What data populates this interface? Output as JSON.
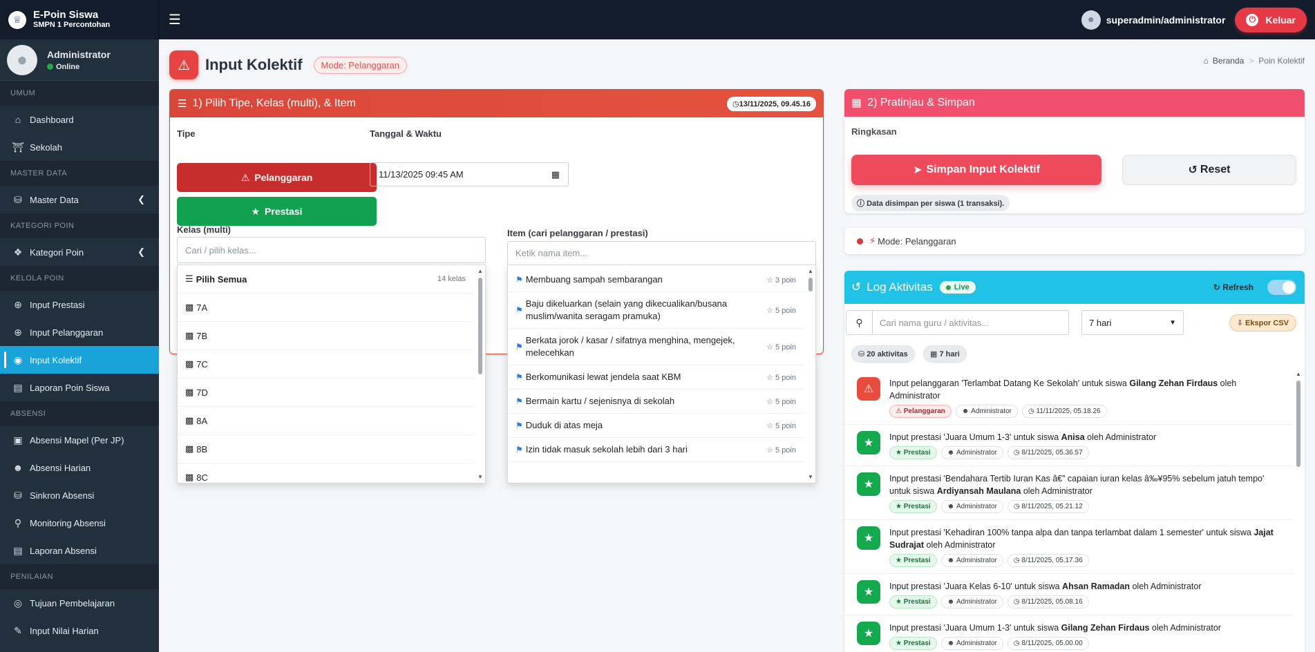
{
  "app": {
    "title": "E-Poin Siswa",
    "subtitle": "SMPN 1 Percontohan"
  },
  "topbar": {
    "user": "superadmin/administrator",
    "logout_label": "Keluar"
  },
  "sidebar": {
    "user_name": "Administrator",
    "user_status": "Online",
    "sections": {
      "umum": "UMUM",
      "master": "MASTER DATA",
      "kategori": "KATEGORI POIN",
      "kelola": "KELOLA POIN",
      "absensi": "ABSENSI",
      "penilaian": "PENILAIAN"
    },
    "items": {
      "dashboard": "Dashboard",
      "sekolah": "Sekolah",
      "master_data": "Master Data",
      "kategori_poin": "Kategori Poin",
      "input_prestasi": "Input Prestasi",
      "input_pelanggaran": "Input Pelanggaran",
      "input_kolektif": "Input Kolektif",
      "laporan_poin": "Laporan Poin Siswa",
      "absensi_mapel": "Absensi Mapel (Per JP)",
      "absensi_harian": "Absensi Harian",
      "sinkron_absensi": "Sinkron Absensi",
      "monitoring_absensi": "Monitoring Absensi",
      "laporan_absensi": "Laporan Absensi",
      "tujuan_pembelajaran": "Tujuan Pembelajaran",
      "input_nilai_harian": "Input Nilai Harian"
    }
  },
  "page": {
    "title": "Input Kolektif",
    "mode_badge": "Mode: Pelanggaran",
    "breadcrumb_home": "Beranda",
    "breadcrumb_current": "Poin Kolektif"
  },
  "form": {
    "header": "1) Pilih Tipe, Kelas (multi), & Item",
    "timestamp": "13/11/2025, 09.45.16",
    "tipe_label": "Tipe",
    "btn_pelanggaran": "Pelanggaran",
    "btn_prestasi": "Prestasi",
    "datetime_label": "Tanggal & Waktu",
    "datetime_value": "11/13/2025 09:45 AM",
    "kelas_label": "Kelas (multi)",
    "kelas_placeholder": "Cari / pilih kelas...",
    "item_label": "Item (cari pelanggaran / prestasi)",
    "item_placeholder": "Ketik nama item...",
    "select_all": "Pilih Semua",
    "kelas_count": "14 kelas",
    "kelas_options": [
      "7A",
      "7B",
      "7C",
      "7D",
      "8A",
      "8B",
      "8C"
    ],
    "item_options": [
      {
        "name": "Membuang sampah sembarangan",
        "poin": "3 poin"
      },
      {
        "name": "Baju dikeluarkan (selain yang dikecualikan/busana muslim/wanita seragam pramuka)",
        "poin": "5 poin"
      },
      {
        "name": "Berkata jorok / kasar / sifatnya menghina, mengejek, melecehkan",
        "poin": "5 poin"
      },
      {
        "name": "Berkomunikasi lewat jendela saat KBM",
        "poin": "5 poin"
      },
      {
        "name": "Bermain kartu / sejenisnya di sekolah",
        "poin": "5 poin"
      },
      {
        "name": "Duduk di atas meja",
        "poin": "5 poin"
      },
      {
        "name": "Izin tidak masuk sekolah lebih dari 3 hari",
        "poin": "5 poin"
      }
    ]
  },
  "preview": {
    "header": "2) Pratinjau & Simpan",
    "summary_label": "Ringkasan",
    "save_label": "Simpan Input Kolektif",
    "reset_label": "Reset",
    "info": "Data disimpan per siswa (1 transaksi).",
    "mode": "Mode: Pelanggaran"
  },
  "log": {
    "title": "Log Aktivitas",
    "live": "Live",
    "refresh": "Refresh",
    "search_placeholder": "Cari nama guru / aktivitas...",
    "range_value": "7 hari",
    "export": "Ekspor CSV",
    "count_chip": "20 aktivitas",
    "range_chip": "7 hari",
    "entries": [
      {
        "type": "pelanggaran",
        "prefix": "Input pelanggaran 'Terlambat Datang Ke Sekolah' untuk siswa ",
        "student": "Gilang Zehan Firdaus",
        "suffix": " oleh Administrator",
        "badge": "Pelanggaran",
        "user": "Administrator",
        "time": "11/11/2025, 05.18.26"
      },
      {
        "type": "prestasi",
        "prefix": "Input prestasi 'Juara Umum 1-3' untuk siswa ",
        "student": "Anisa",
        "suffix": " oleh Administrator",
        "badge": "Prestasi",
        "user": "Administrator",
        "time": "8/11/2025, 05.36.57"
      },
      {
        "type": "prestasi",
        "prefix": "Input prestasi 'Bendahara Tertib Iuran Kas â€” capaian iuran kelas â‰¥95% sebelum jatuh tempo' untuk siswa ",
        "student": "Ardiyansah Maulana",
        "suffix": " oleh Administrator",
        "badge": "Prestasi",
        "user": "Administrator",
        "time": "8/11/2025, 05.21.12"
      },
      {
        "type": "prestasi",
        "prefix": "Input prestasi 'Kehadiran 100% tanpa alpa dan tanpa terlambat dalam 1 semester' untuk siswa ",
        "student": "Jajat Sudrajat",
        "suffix": " oleh Administrator",
        "badge": "Prestasi",
        "user": "Administrator",
        "time": "8/11/2025, 05.17.36"
      },
      {
        "type": "prestasi",
        "prefix": "Input prestasi 'Juara Kelas 6-10' untuk siswa ",
        "student": "Ahsan Ramadan",
        "suffix": " oleh Administrator",
        "badge": "Prestasi",
        "user": "Administrator",
        "time": "8/11/2025, 05.08.16"
      },
      {
        "type": "prestasi",
        "prefix": "Input prestasi 'Juara Umum 1-3' untuk siswa ",
        "student": "Gilang Zehan Firdaus",
        "suffix": " oleh Administrator",
        "badge": "Prestasi",
        "user": "Administrator",
        "time": "8/11/2025, 05.00.00"
      }
    ]
  },
  "colors": {
    "accent": "#1aa3d9",
    "danger": "#e84343",
    "success": "#12a150"
  }
}
